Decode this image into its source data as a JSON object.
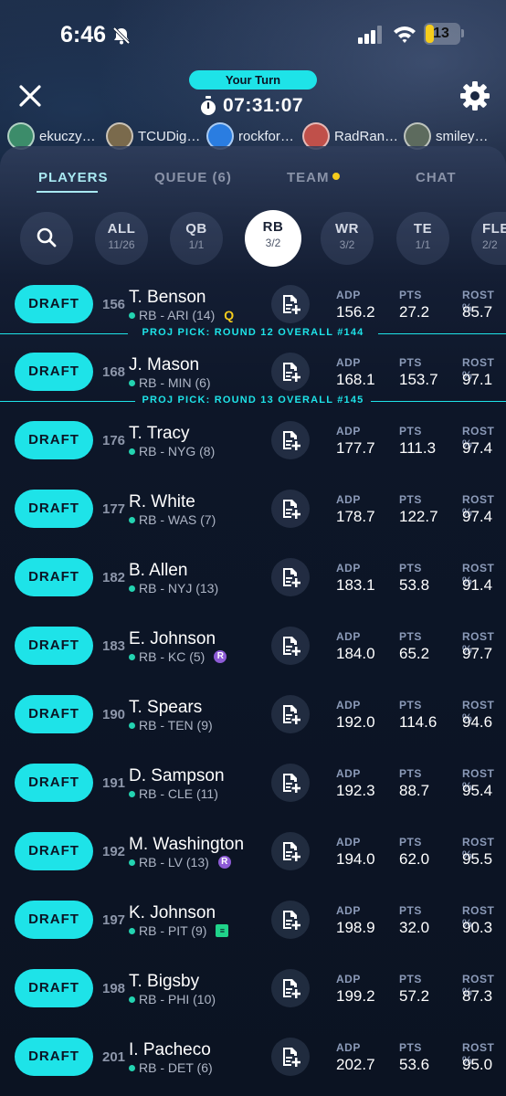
{
  "status_bar": {
    "time": "6:46",
    "battery": "13"
  },
  "header": {
    "turn_label": "Your Turn",
    "timer": "07:31:07"
  },
  "drafters": [
    {
      "name": "ekuczy…",
      "avatar_color": "#3c8c6a"
    },
    {
      "name": "TCUDig…",
      "avatar_color": "#7a6a4c"
    },
    {
      "name": "rockfor…",
      "avatar_color": "#2a7de1"
    },
    {
      "name": "RadRan…",
      "avatar_color": "#c0504a"
    },
    {
      "name": "smiley…",
      "avatar_color": "#5d6b5e"
    }
  ],
  "tabs": [
    {
      "label": "PLAYERS",
      "active": true
    },
    {
      "label": "QUEUE (6)",
      "active": false
    },
    {
      "label": "TEAM",
      "active": false,
      "indicator_color": "#f5cc1c"
    },
    {
      "label": "CHAT",
      "active": false
    }
  ],
  "filters": [
    {
      "label": "ALL",
      "count": "11/26",
      "active": false
    },
    {
      "label": "QB",
      "count": "1/1",
      "active": false
    },
    {
      "label": "RB",
      "count": "3/2",
      "active": true
    },
    {
      "label": "WR",
      "count": "3/2",
      "active": false
    },
    {
      "label": "TE",
      "count": "1/1",
      "active": false
    },
    {
      "label": "FLE",
      "count": "2/2",
      "active": false
    }
  ],
  "stat_headers": {
    "adp": "ADP",
    "pts": "PTS",
    "rost": "ROST %"
  },
  "draft_label": "DRAFT",
  "proj_picks": [
    "PROJ PICK: ROUND 12 OVERALL #144",
    "PROJ PICK: ROUND 13 OVERALL #145"
  ],
  "players": [
    {
      "rank": "156",
      "name": "T. Benson",
      "meta": "RB - ARI (14)",
      "tag": "Q",
      "adp": "156.2",
      "pts": "27.2",
      "rost": "85.7"
    },
    {
      "rank": "168",
      "name": "J. Mason",
      "meta": "RB - MIN (6)",
      "tag": "",
      "adp": "168.1",
      "pts": "153.7",
      "rost": "97.1"
    },
    {
      "rank": "176",
      "name": "T. Tracy",
      "meta": "RB - NYG (8)",
      "tag": "",
      "adp": "177.7",
      "pts": "111.3",
      "rost": "97.4"
    },
    {
      "rank": "177",
      "name": "R. White",
      "meta": "RB - WAS (7)",
      "tag": "",
      "adp": "178.7",
      "pts": "122.7",
      "rost": "97.4"
    },
    {
      "rank": "182",
      "name": "B. Allen",
      "meta": "RB - NYJ (13)",
      "tag": "",
      "adp": "183.1",
      "pts": "53.8",
      "rost": "91.4"
    },
    {
      "rank": "183",
      "name": "E. Johnson",
      "meta": "RB - KC (5)",
      "tag": "R",
      "adp": "184.0",
      "pts": "65.2",
      "rost": "97.7"
    },
    {
      "rank": "190",
      "name": "T. Spears",
      "meta": "RB - TEN (9)",
      "tag": "",
      "adp": "192.0",
      "pts": "114.6",
      "rost": "94.6"
    },
    {
      "rank": "191",
      "name": "D. Sampson",
      "meta": "RB - CLE (11)",
      "tag": "",
      "adp": "192.3",
      "pts": "88.7",
      "rost": "95.4"
    },
    {
      "rank": "192",
      "name": "M. Washington",
      "meta": "RB - LV (13)",
      "tag": "R",
      "adp": "194.0",
      "pts": "62.0",
      "rost": "95.5"
    },
    {
      "rank": "197",
      "name": "K. Johnson",
      "meta": "RB - PIT (9)",
      "tag": "news",
      "adp": "198.9",
      "pts": "32.0",
      "rost": "90.3"
    },
    {
      "rank": "198",
      "name": "T. Bigsby",
      "meta": "RB - PHI (10)",
      "tag": "",
      "adp": "199.2",
      "pts": "57.2",
      "rost": "87.3"
    },
    {
      "rank": "201",
      "name": "I. Pacheco",
      "meta": "RB - DET (6)",
      "tag": "",
      "adp": "202.7",
      "pts": "53.6",
      "rost": "95.0"
    }
  ],
  "colors": {
    "accent": "#1ee3e8",
    "team_dot": "#23d3b1",
    "warning": "#f5cc1c",
    "rookie": "#8d5bd6"
  }
}
